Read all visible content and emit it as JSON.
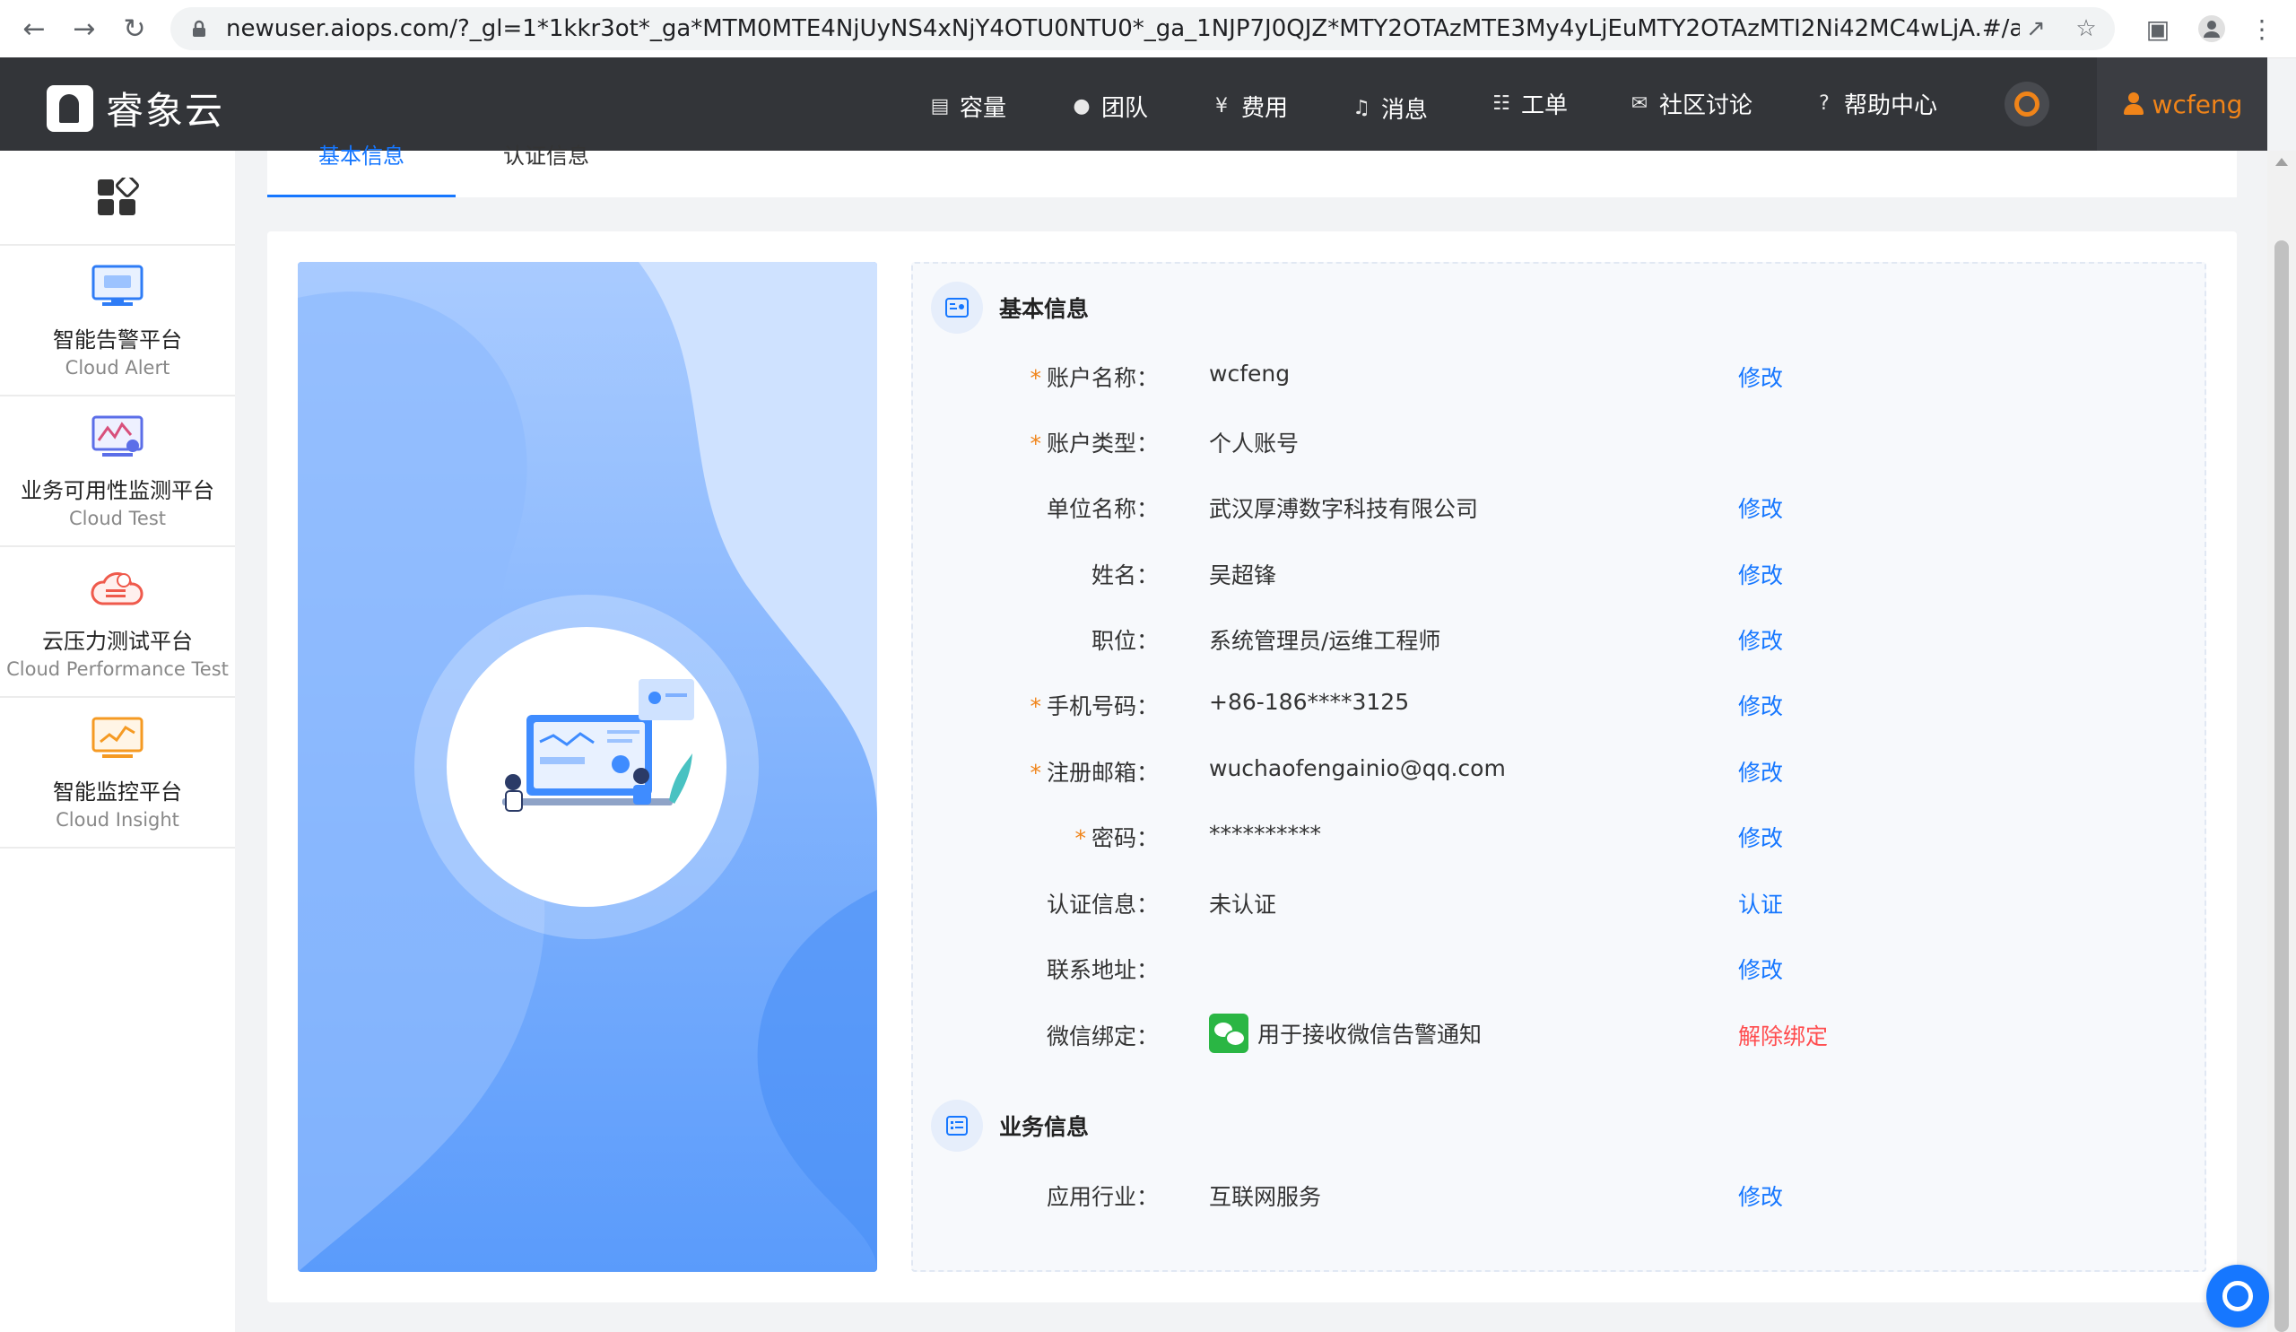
{
  "browser": {
    "url": "newuser.aiops.com/?_gl=1*1kkr3ot*_ga*MTM0MTE4NjUyNS4xNjY4OTU0NTU0*_ga_1NJP7J0QJZ*MTY2OTAzMTE3My4yLjEuMTY2OTAzMTI2Ni42MC4wLjA.#/account/bas..."
  },
  "header": {
    "logo_text": "睿象云",
    "nav": [
      {
        "label": "容量",
        "icon": "storage-icon"
      },
      {
        "label": "团队",
        "icon": "team-icon"
      },
      {
        "label": "费用",
        "icon": "money-icon"
      },
      {
        "label": "消息",
        "icon": "bell-icon"
      },
      {
        "label": "工单",
        "icon": "clipboard-icon"
      },
      {
        "label": "社区讨论",
        "icon": "chat-icon"
      },
      {
        "label": "帮助中心",
        "icon": "help-icon"
      }
    ],
    "username": "wcfeng"
  },
  "sidebar": {
    "items": [
      {
        "cn": "智能告警平台",
        "en": "Cloud Alert",
        "icon": "cloud-alert-icon"
      },
      {
        "cn": "业务可用性监测平台",
        "en": "Cloud Test",
        "icon": "cloud-test-icon"
      },
      {
        "cn": "云压力测试平台",
        "en": "Cloud Performance Test",
        "icon": "cloud-performance-icon"
      },
      {
        "cn": "智能监控平台",
        "en": "Cloud Insight",
        "icon": "cloud-insight-icon"
      }
    ]
  },
  "tabs": [
    {
      "label": "基本信息",
      "active": true
    },
    {
      "label": "认证信息",
      "active": false
    }
  ],
  "basic": {
    "title": "基本信息",
    "rows": [
      {
        "label": "账户名称：",
        "required": "*",
        "value": "wcfeng",
        "action": "修改"
      },
      {
        "label": "账户类型：",
        "required": "*",
        "value": "个人账号",
        "action": ""
      },
      {
        "label": "单位名称：",
        "required": "",
        "value": "武汉厚溥数字科技有限公司",
        "action": "修改"
      },
      {
        "label": "姓名：",
        "required": "",
        "value": "吴超锋",
        "action": "修改"
      },
      {
        "label": "职位：",
        "required": "",
        "value": "系统管理员/运维工程师",
        "action": "修改"
      },
      {
        "label": "手机号码：",
        "required": "*",
        "value": "+86-186****3125",
        "action": "修改"
      },
      {
        "label": "注册邮箱：",
        "required": "*",
        "value": "wuchaofengainio@qq.com",
        "action": "修改"
      },
      {
        "label": "密码：",
        "required": "*",
        "value": "**********",
        "action": "修改"
      },
      {
        "label": "认证信息：",
        "required": "",
        "value": "未认证",
        "action": "认证"
      },
      {
        "label": "联系地址：",
        "required": "",
        "value": "",
        "action": "修改"
      }
    ],
    "wechat": {
      "label": "微信绑定：",
      "value": "用于接收微信告警通知",
      "action": "解除绑定"
    }
  },
  "business": {
    "title": "业务信息",
    "rows": [
      {
        "label": "应用行业：",
        "value": "互联网服务",
        "action": "修改"
      }
    ]
  },
  "colors": {
    "accent": "#1677ff",
    "danger": "#ff4d4f",
    "required": "#f08419",
    "user": "#f08419"
  }
}
